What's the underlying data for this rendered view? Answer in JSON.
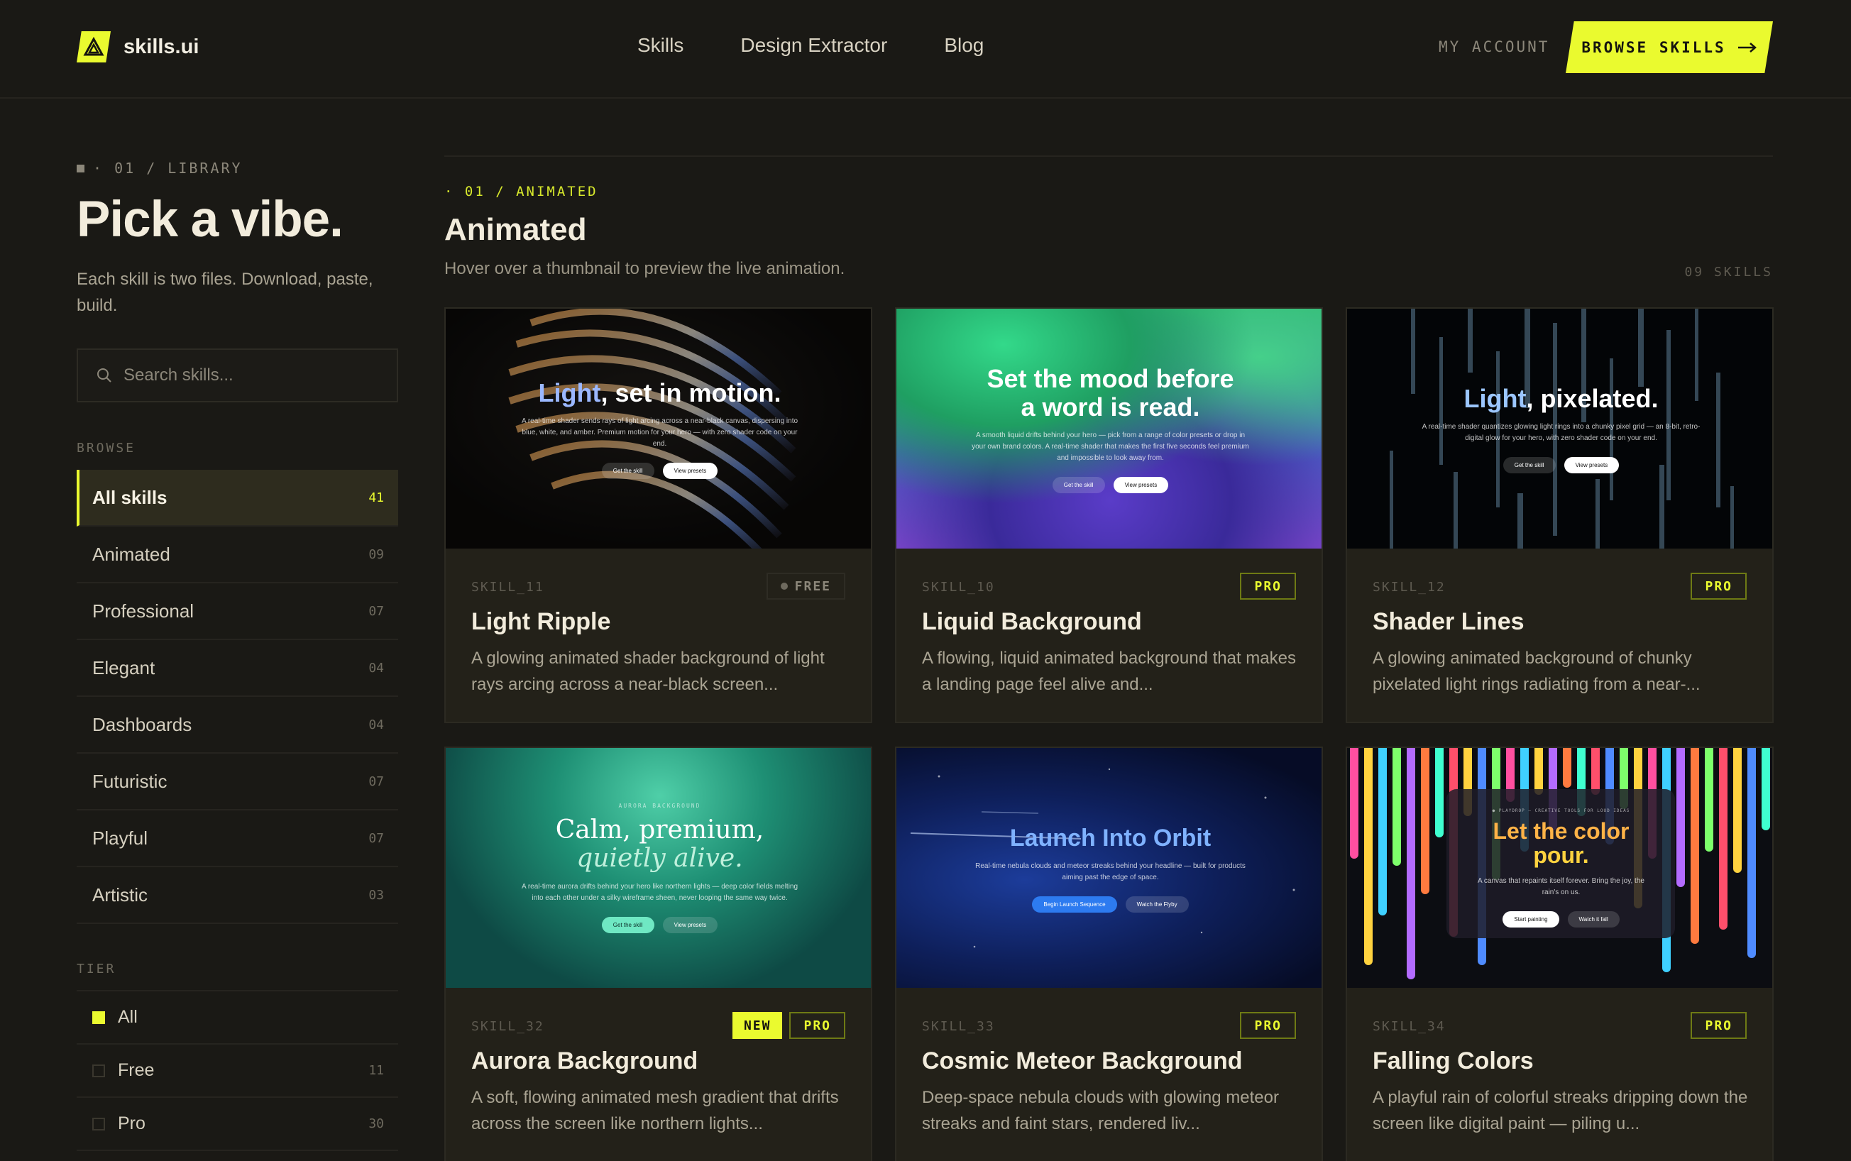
{
  "header": {
    "brand": "skills.ui",
    "nav": [
      "Skills",
      "Design Extractor",
      "Blog"
    ],
    "my_account": "MY ACCOUNT",
    "browse_button": "BROWSE SKILLS"
  },
  "sidebar": {
    "eyebrow": "· 01 / LIBRARY",
    "title": "Pick a vibe.",
    "subtitle": "Each skill is two files. Download, paste, build.",
    "search_placeholder": "Search skills...",
    "browse_label": "BROWSE",
    "categories": [
      {
        "label": "All skills",
        "count": "41",
        "active": true
      },
      {
        "label": "Animated",
        "count": "09"
      },
      {
        "label": "Professional",
        "count": "07"
      },
      {
        "label": "Elegant",
        "count": "04"
      },
      {
        "label": "Dashboards",
        "count": "04"
      },
      {
        "label": "Futuristic",
        "count": "07"
      },
      {
        "label": "Playful",
        "count": "07"
      },
      {
        "label": "Artistic",
        "count": "03"
      }
    ],
    "tier_label": "TIER",
    "tiers": [
      {
        "label": "All",
        "count": "",
        "checked": true
      },
      {
        "label": "Free",
        "count": "11"
      },
      {
        "label": "Pro",
        "count": "30"
      }
    ]
  },
  "main": {
    "eyebrow": "· 01 / ANIMATED",
    "title": "Animated",
    "subtitle": "Hover over a thumbnail to preview the live animation.",
    "count": "09 SKILLS",
    "cards": [
      {
        "id": "SKILL_11",
        "badges": [
          "FREE"
        ],
        "title": "Light Ripple",
        "desc": "A glowing animated shader background of light rays arcing across a near-black screen...",
        "thumb": {
          "head_a": "Light",
          "head_b": ", set in motion.",
          "body": "A real-time shader sends rays of light arcing across a near-black canvas, dispersing into blue, white, and amber. Premium motion for your hero — with zero shader code on your end.",
          "btn1": "Get the skill",
          "btn2": "View presets"
        }
      },
      {
        "id": "SKILL_10",
        "badges": [
          "PRO"
        ],
        "title": "Liquid Background",
        "desc": "A flowing, liquid animated background that makes a landing page feel alive and...",
        "thumb": {
          "head_a": "Set the mood before",
          "head_b": "a word is read.",
          "body": "A smooth liquid drifts behind your hero — pick from a range of color presets or drop in your own brand colors. A real-time shader that makes the first five seconds feel premium and impossible to look away from.",
          "btn1": "Get the skill",
          "btn2": "View presets"
        }
      },
      {
        "id": "SKILL_12",
        "badges": [
          "PRO"
        ],
        "title": "Shader Lines",
        "desc": "A glowing animated background of chunky pixelated light rings radiating from a near-...",
        "thumb": {
          "head_a": "Light",
          "head_b": ", pixelated.",
          "body": "A real-time shader quantizes glowing light rings into a chunky pixel grid — an 8-bit, retro-digital glow for your hero, with zero shader code on your end.",
          "btn1": "Get the skill",
          "btn2": "View presets"
        }
      },
      {
        "id": "SKILL_32",
        "badges": [
          "NEW",
          "PRO"
        ],
        "title": "Aurora Background",
        "desc": "A soft, flowing animated mesh gradient that drifts across the screen like northern lights...",
        "thumb": {
          "eyebrow": "AURORA BACKGROUND",
          "head_a": "Calm, premium,",
          "head_b": "quietly alive.",
          "body": "A real-time aurora drifts behind your hero like northern lights — deep color fields melting into each other under a silky wireframe sheen, never looping the same way twice.",
          "btn1": "Get the skill",
          "btn2": "View presets"
        }
      },
      {
        "id": "SKILL_33",
        "badges": [
          "PRO"
        ],
        "title": "Cosmic Meteor Background",
        "desc": "Deep-space nebula clouds with glowing meteor streaks and faint stars, rendered liv...",
        "thumb": {
          "head_a": "Launch Into Orbit",
          "head_b": "",
          "body": "Real-time nebula clouds and meteor streaks behind your headline — built for products aiming past the edge of space.",
          "btn1": "Begin Launch Sequence",
          "btn2": "Watch the Flyby"
        }
      },
      {
        "id": "SKILL_34",
        "badges": [
          "PRO"
        ],
        "title": "Falling Colors",
        "desc": "A playful rain of colorful streaks dripping down the screen like digital paint — piling u...",
        "thumb": {
          "eyebrow": "● PLAYDROP — CREATIVE TOOLS FOR LOUD IDEAS",
          "head_a": "Let the color",
          "head_b": "pour.",
          "body": "A canvas that repaints itself forever. Bring the joy, the rain's on us.",
          "btn1": "Start painting",
          "btn2": "Watch it fall"
        }
      }
    ]
  },
  "colors": {
    "accent": "#eafa2f",
    "background": "#1a1915",
    "card": "#232119"
  },
  "icons": {
    "logo": "triangle-logo-icon",
    "arrow": "arrow-right-icon",
    "search": "search-icon"
  }
}
